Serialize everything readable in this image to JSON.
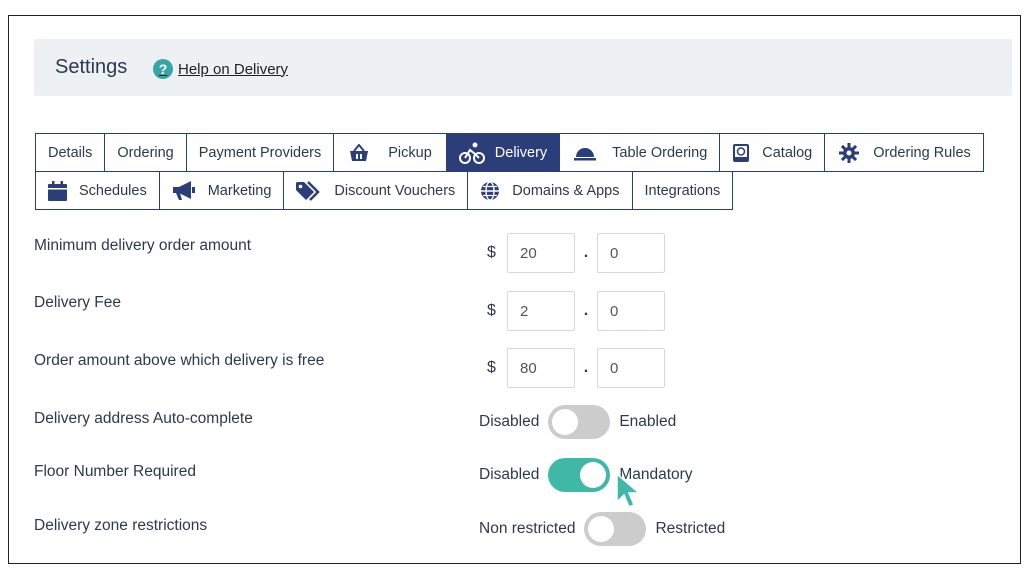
{
  "header": {
    "title": "Settings",
    "help_link": "Help on Delivery"
  },
  "tabs_row1": [
    {
      "label": "Details",
      "icon": ""
    },
    {
      "label": "Ordering",
      "icon": ""
    },
    {
      "label": "Payment Providers",
      "icon": ""
    },
    {
      "label": "Pickup",
      "icon": "basket-icon"
    },
    {
      "label": "Delivery",
      "icon": "bicycle-icon",
      "active": true
    },
    {
      "label": "Table Ordering",
      "icon": "cloche-icon"
    },
    {
      "label": "Catalog",
      "icon": "book-icon"
    },
    {
      "label": "Ordering Rules",
      "icon": "gear-icon"
    }
  ],
  "tabs_row2": [
    {
      "label": "Schedules",
      "icon": "calendar-icon"
    },
    {
      "label": "Marketing",
      "icon": "megaphone-icon"
    },
    {
      "label": "Discount Vouchers",
      "icon": "tag-icon"
    },
    {
      "label": "Domains & Apps",
      "icon": "globe-icon"
    },
    {
      "label": "Integrations",
      "icon": ""
    }
  ],
  "fields": {
    "min_order": {
      "label": "Minimum delivery order amount",
      "currency": "$",
      "whole": "20",
      "fraction": "0"
    },
    "delivery_fee": {
      "label": "Delivery Fee",
      "currency": "$",
      "whole": "2",
      "fraction": "0"
    },
    "free_above": {
      "label": "Order amount above which delivery is free",
      "currency": "$",
      "whole": "80",
      "fraction": "0"
    }
  },
  "toggles": {
    "autocomplete": {
      "label": "Delivery address Auto-complete",
      "left": "Disabled",
      "right": "Enabled",
      "state": "off"
    },
    "floor": {
      "label": "Floor Number Required",
      "left": "Disabled",
      "right": "Mandatory",
      "state": "on"
    },
    "zone": {
      "label": "Delivery zone restrictions",
      "left": "Non restricted",
      "right": "Restricted",
      "state": "off"
    }
  },
  "colors": {
    "accent": "#2b3e7a",
    "toggle_on": "#3fb8a8",
    "toggle_off": "#cccccc",
    "help_icon": "#37a6a6"
  }
}
